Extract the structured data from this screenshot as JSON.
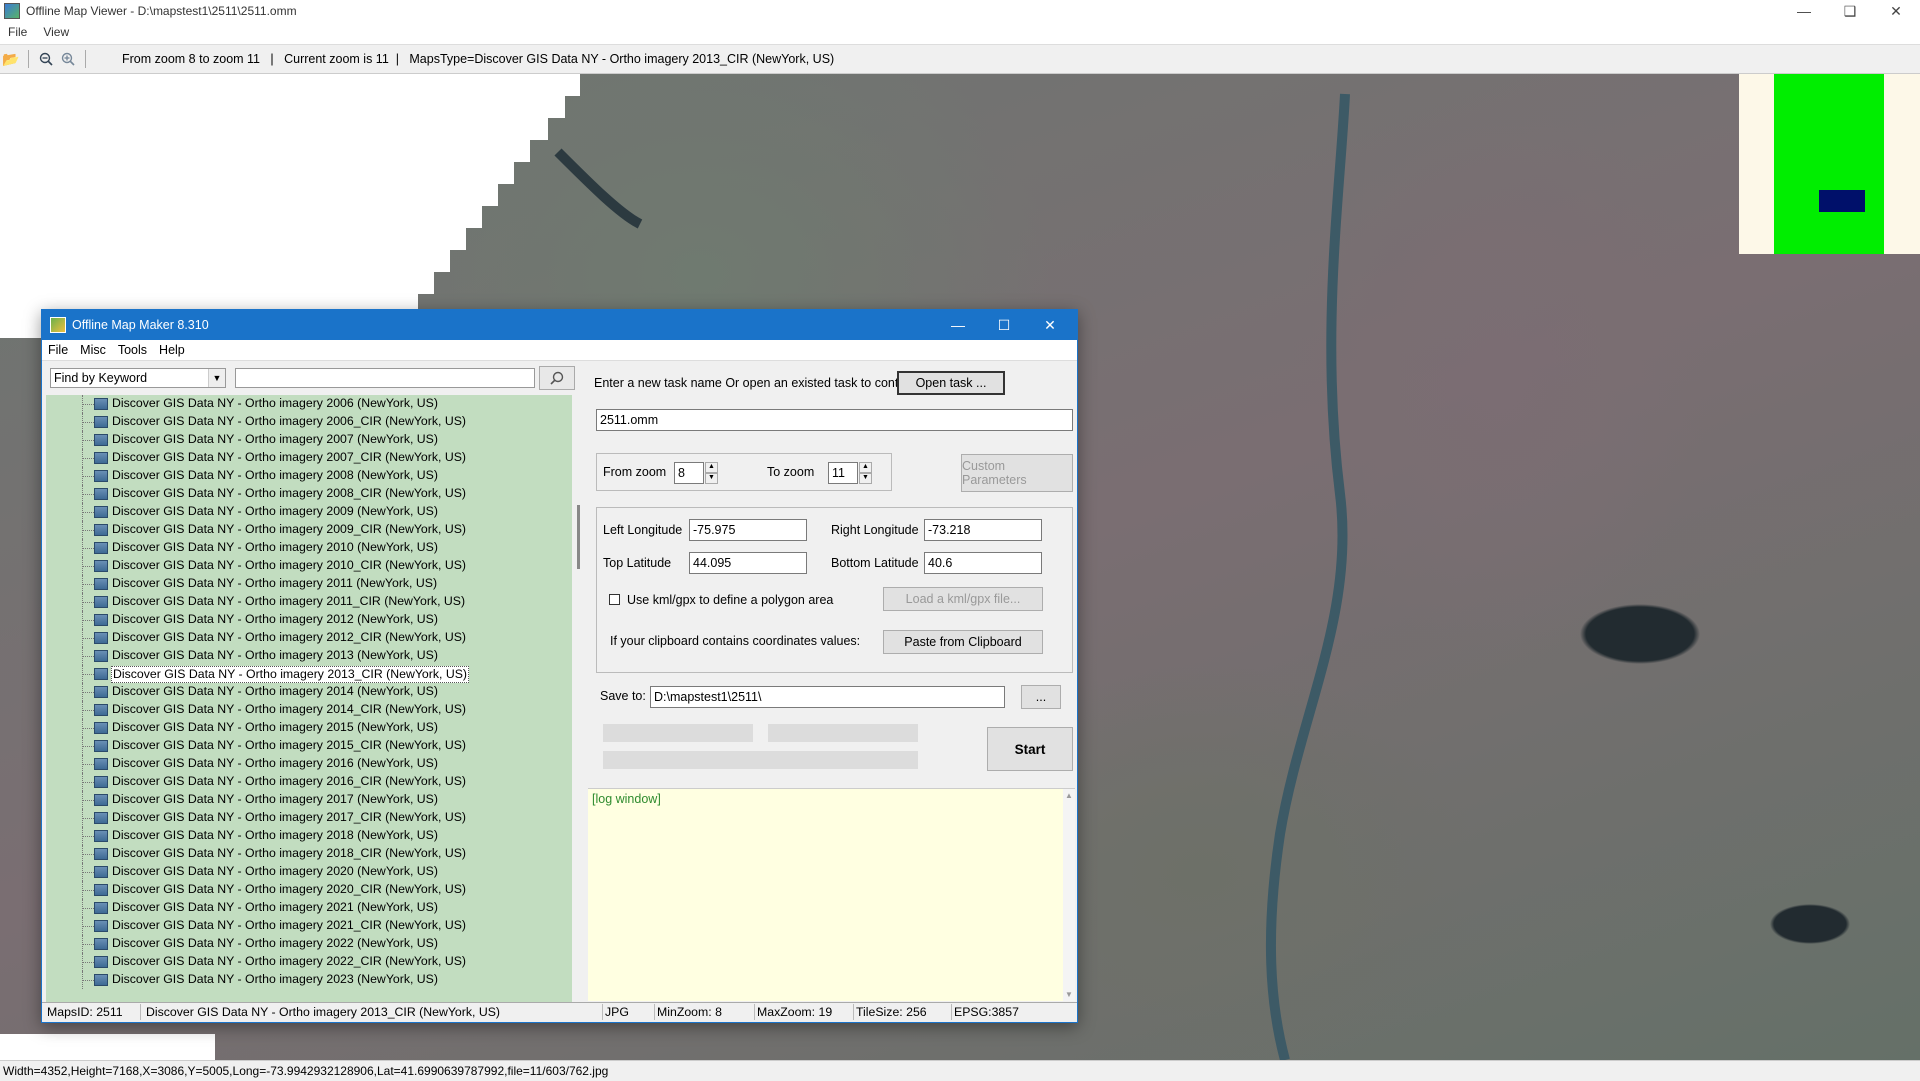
{
  "main_window": {
    "title": "Offline Map Viewer - D:\\mapstest1\\2511\\2511.omm",
    "menu": [
      "File",
      "View"
    ],
    "toolbar_info": "From zoom 8 to zoom 11   |   Current zoom is 11  |   MapsType=Discover GIS Data NY - Ortho imagery 2013_CIR (NewYork, US)",
    "status": "Width=4352,Height=7168,X=3086,Y=5005,Long=-73.9942932128906,Lat=41.6990639787992,file=11/603/762.jpg"
  },
  "dialog": {
    "title": "Offline Map Maker 8.310",
    "menu": [
      "File",
      "Misc",
      "Tools",
      "Help"
    ],
    "keyword_select": "Find by Keyword",
    "keyword_input": "",
    "tree_items": [
      "Discover GIS Data NY - Ortho imagery 2006 (NewYork, US)",
      "Discover GIS Data NY - Ortho imagery 2006_CIR (NewYork, US)",
      "Discover GIS Data NY - Ortho imagery 2007 (NewYork, US)",
      "Discover GIS Data NY - Ortho imagery 2007_CIR (NewYork, US)",
      "Discover GIS Data NY - Ortho imagery 2008 (NewYork, US)",
      "Discover GIS Data NY - Ortho imagery 2008_CIR (NewYork, US)",
      "Discover GIS Data NY - Ortho imagery 2009 (NewYork, US)",
      "Discover GIS Data NY - Ortho imagery 2009_CIR (NewYork, US)",
      "Discover GIS Data NY - Ortho imagery 2010 (NewYork, US)",
      "Discover GIS Data NY - Ortho imagery 2010_CIR (NewYork, US)",
      "Discover GIS Data NY - Ortho imagery 2011 (NewYork, US)",
      "Discover GIS Data NY - Ortho imagery 2011_CIR (NewYork, US)",
      "Discover GIS Data NY - Ortho imagery 2012 (NewYork, US)",
      "Discover GIS Data NY - Ortho imagery 2012_CIR (NewYork, US)",
      "Discover GIS Data NY - Ortho imagery 2013 (NewYork, US)",
      "Discover GIS Data NY - Ortho imagery 2013_CIR (NewYork, US)",
      "Discover GIS Data NY - Ortho imagery 2014 (NewYork, US)",
      "Discover GIS Data NY - Ortho imagery 2014_CIR (NewYork, US)",
      "Discover GIS Data NY - Ortho imagery 2015 (NewYork, US)",
      "Discover GIS Data NY - Ortho imagery 2015_CIR (NewYork, US)",
      "Discover GIS Data NY - Ortho imagery 2016 (NewYork, US)",
      "Discover GIS Data NY - Ortho imagery 2016_CIR (NewYork, US)",
      "Discover GIS Data NY - Ortho imagery 2017 (NewYork, US)",
      "Discover GIS Data NY - Ortho imagery 2017_CIR (NewYork, US)",
      "Discover GIS Data NY - Ortho imagery 2018 (NewYork, US)",
      "Discover GIS Data NY - Ortho imagery 2018_CIR (NewYork, US)",
      "Discover GIS Data NY - Ortho imagery 2020 (NewYork, US)",
      "Discover GIS Data NY - Ortho imagery 2020_CIR (NewYork, US)",
      "Discover GIS Data NY - Ortho imagery 2021 (NewYork, US)",
      "Discover GIS Data NY - Ortho imagery 2021_CIR (NewYork, US)",
      "Discover GIS Data NY - Ortho imagery 2022 (NewYork, US)",
      "Discover GIS Data NY - Ortho imagery 2022_CIR (NewYork, US)",
      "Discover GIS Data NY - Ortho imagery 2023 (NewYork, US)"
    ],
    "selected_index": 15,
    "task_prompt": "Enter a new task name Or open an existed task to continue:",
    "open_task_label": "Open task ...",
    "task_name": "2511.omm",
    "from_zoom_label": "From zoom",
    "from_zoom": "8",
    "to_zoom_label": "To zoom",
    "to_zoom": "11",
    "custom_params_label": "Custom Parameters",
    "left_lon_label": "Left Longitude",
    "left_lon": "-75.975",
    "right_lon_label": "Right Longitude",
    "right_lon": "-73.218",
    "top_lat_label": "Top Latitude",
    "top_lat": "44.095",
    "bottom_lat_label": "Bottom Latitude",
    "bottom_lat": "40.6",
    "kml_checkbox_label": "Use kml/gpx to define a polygon area",
    "load_kml_label": "Load a kml/gpx file...",
    "clipboard_prompt": "If your clipboard contains coordinates values:",
    "paste_label": "Paste from Clipboard",
    "save_to_label": "Save to:",
    "save_path": "D:\\mapstest1\\2511\\",
    "browse_label": "...",
    "start_label": "Start",
    "log_text": "[log window]",
    "status": {
      "maps_id": "MapsID: 2511",
      "map_name": "Discover GIS Data NY - Ortho imagery 2013_CIR (NewYork, US)",
      "format": "JPG",
      "min_zoom": "MinZoom: 8",
      "max_zoom": "MaxZoom: 19",
      "tile_size": "TileSize: 256",
      "epsg": "EPSG:3857"
    }
  },
  "icons": {
    "search": "magnifier",
    "zoom_out": "magnifier-minus",
    "zoom_in": "magnifier-plus",
    "open": "folder"
  },
  "colors": {
    "dialog_title": "#1a73c9",
    "tree_bg": "#c2ddc0",
    "log_bg": "#ffffe1",
    "overview_green": "#00ee00",
    "overview_blue": "#00106a"
  }
}
